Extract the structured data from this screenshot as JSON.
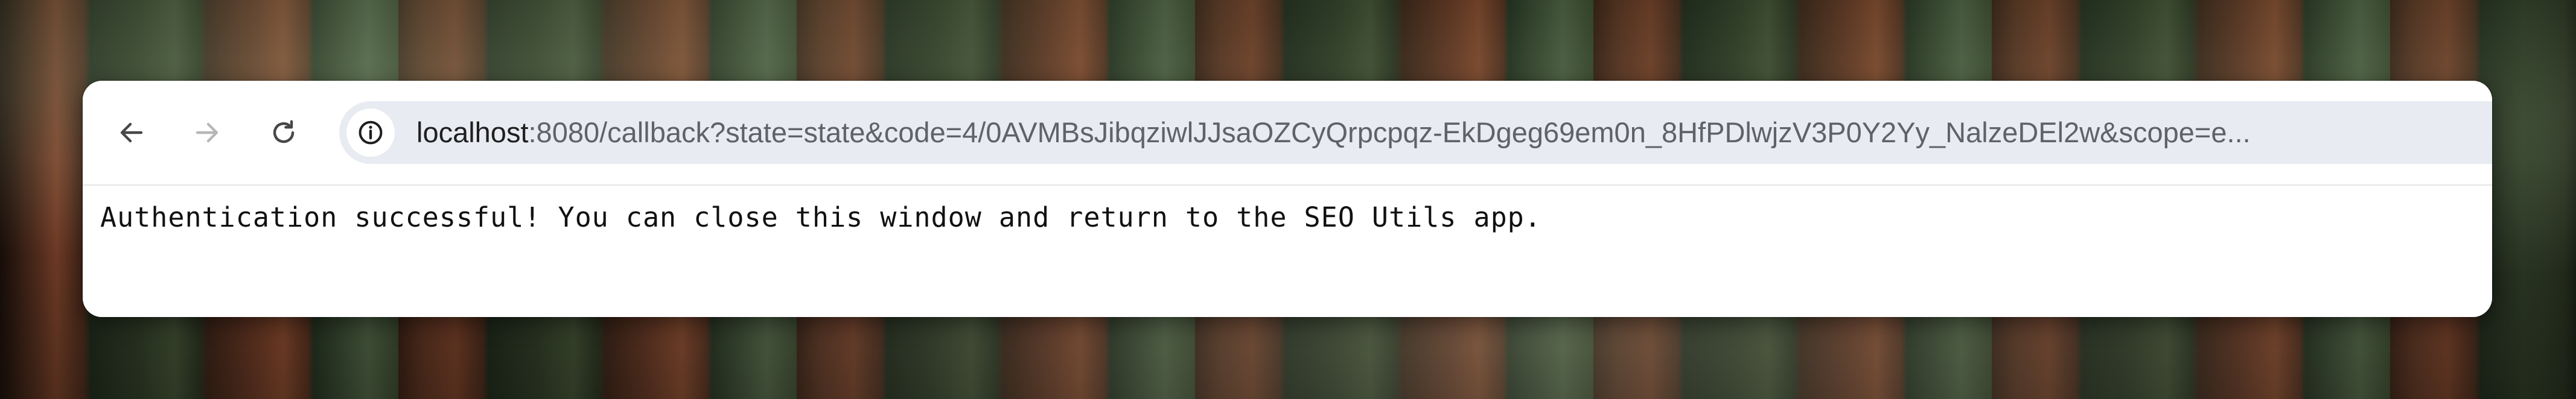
{
  "browser": {
    "toolbar": {
      "back_icon": "arrow-left-icon",
      "forward_icon": "arrow-right-icon",
      "reload_icon": "reload-icon",
      "site_info_icon": "info-circle-icon"
    },
    "address_bar": {
      "host": "localhost",
      "rest": ":8080/callback?state=state&code=4/0AVMBsJibqziwlJJsaOZCyQrpcpqz-EkDgeg69em0n_8HfPDlwjzV3P0Y2Yy_NalzeDEl2w&scope=e..."
    }
  },
  "page": {
    "message": "Authentication successful! You can close this window and return to the SEO Utils app."
  },
  "colors": {
    "toolbar_bg": "#ffffff",
    "omnibox_bg": "#e8ebf1",
    "icon_active": "#474747",
    "icon_disabled": "#b7b7b7",
    "url_host": "#1f1f1f",
    "url_rest": "#5f6368"
  }
}
